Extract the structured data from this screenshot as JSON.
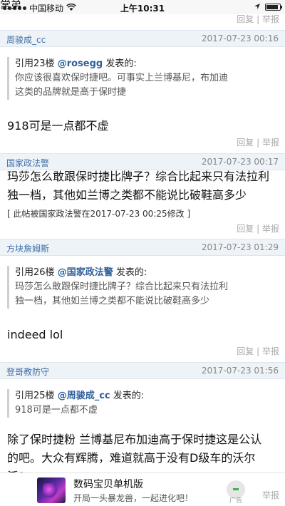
{
  "status_bar": {
    "carrier": "中国移动",
    "time": "上午10:31",
    "overlay_title": "常弟"
  },
  "actions": {
    "reply": "回复",
    "separator": "|",
    "report": "举报"
  },
  "posts": [
    {
      "author": "周骏成_cc",
      "timestamp": "2017-07-23 00:16",
      "quote": {
        "prefix": "引用23楼",
        "user": "@rosegg",
        "suffix": "发表的:",
        "lines": [
          "你应该很喜欢保时捷吧。可事实上兰博基尼，布加迪",
          "这类的品牌就是高于保时捷"
        ]
      },
      "body": [
        "918可是一点都不虚"
      ]
    },
    {
      "author": "国家政法警",
      "timestamp": "2017-07-23 00:17",
      "body": [
        "玛莎怎么敢跟保时捷比牌子？综合比起来只有法拉利",
        "独一档，其他如兰博之类都不能说比破鞋高多少"
      ],
      "edit_note": "[ 此帖被国家政法警在2017-07-23 00:25修改 ]"
    },
    {
      "author": "方块詹姆斯",
      "timestamp": "2017-07-23 01:29",
      "quote": {
        "prefix": "引用26楼",
        "user": "@国家政法警",
        "suffix": "发表的:",
        "lines": [
          "玛莎怎么敢跟保时捷比牌子？综合比起来只有法拉利",
          "独一档，其他如兰博之类都不能说比破鞋高多少"
        ]
      },
      "body": [
        "indeed lol"
      ]
    },
    {
      "author": "登哥教防守",
      "timestamp": "2017-07-23 01:56",
      "quote": {
        "prefix": "引用25楼",
        "user": "@周骏成_cc",
        "suffix": "发表的:",
        "lines": [
          "918可是一点都不虚"
        ]
      },
      "body": [
        "除了保时捷粉 兰博基尼布加迪高于保时捷这是公认",
        "的吧。大众有辉腾，难道就高于没有D级车的沃尔",
        "沃?"
      ]
    }
  ],
  "ad": {
    "title": "数码宝贝单机版",
    "description": "开局一头暴龙兽，一起进化吧！",
    "tag": "广告"
  }
}
